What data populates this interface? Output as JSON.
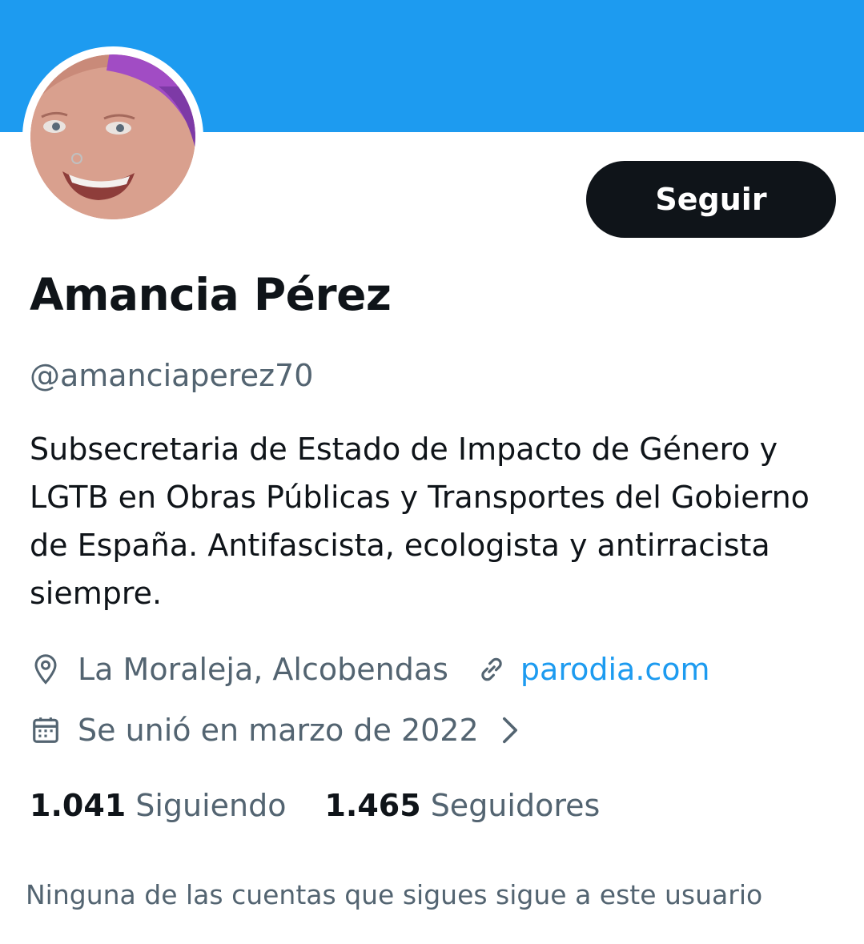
{
  "profile": {
    "banner_color": "#1d9bf0",
    "avatar_icon": "profile-photo",
    "follow_label": "Seguir",
    "display_name": "Amancia Pérez",
    "handle": "@amanciaperez70",
    "bio": "Subsecretaria de Estado de Impacto de Género y LGTB en Obras Públicas y Transportes del Gobierno de España. Antifascista, ecologista y antirracista siempre.",
    "location": "La Moraleja, Alcobendas",
    "website": "parodia.com",
    "joined": "Se unió en marzo de 2022",
    "following_count": "1.041",
    "following_label": "Siguiendo",
    "followers_count": "1.465",
    "followers_label": "Seguidores",
    "mutual_note": "Ninguna de las cuentas que sigues sigue a este usuario"
  },
  "colors": {
    "accent": "#1d9bf0",
    "text_primary": "#0f1419",
    "text_secondary": "#536471"
  }
}
